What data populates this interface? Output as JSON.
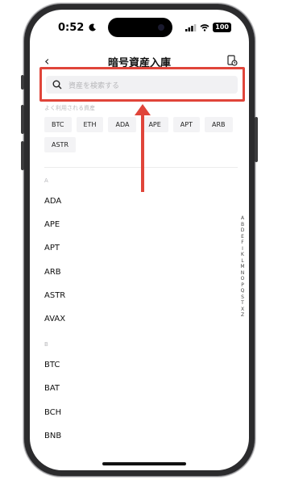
{
  "status_bar": {
    "time": "0:52",
    "battery": "100"
  },
  "nav": {
    "back": "‹",
    "title": "暗号資産入庫"
  },
  "search": {
    "placeholder": "資産を検索する"
  },
  "frequent": {
    "label": "よく利用される資産",
    "chips": [
      "BTC",
      "ETH",
      "ADA",
      "APE",
      "APT",
      "ARB",
      "ASTR"
    ]
  },
  "sections": [
    {
      "letter": "A",
      "items": [
        "ADA",
        "APE",
        "APT",
        "ARB",
        "ASTR",
        "AVAX"
      ]
    },
    {
      "letter": "B",
      "items": [
        "BTC",
        "BAT",
        "BCH",
        "BNB"
      ]
    }
  ],
  "alpha_index": [
    "A",
    "B",
    "D",
    "E",
    "F",
    "I",
    "K",
    "L",
    "M",
    "N",
    "O",
    "P",
    "Q",
    "S",
    "T",
    "X",
    "Z"
  ],
  "colors": {
    "highlight": "#e0453a",
    "chip_bg": "#f3f3f5",
    "search_bg": "#f1f1f3"
  }
}
